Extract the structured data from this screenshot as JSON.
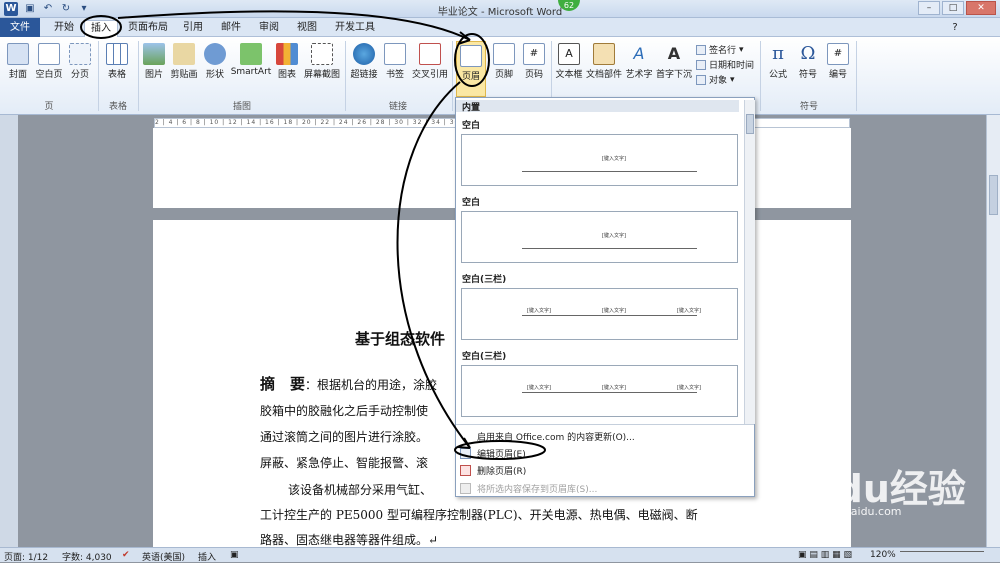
{
  "window": {
    "title": "毕业论文 - Microsoft Word",
    "badge": "62"
  },
  "tabs": {
    "file": "文件",
    "home": "开始",
    "insert": "插入",
    "layout": "页面布局",
    "ref": "引用",
    "mail": "邮件",
    "review": "审阅",
    "view": "视图",
    "dev": "开发工具"
  },
  "ribbon": {
    "cover": "封面",
    "blank": "空白页",
    "pagebreak": "分页",
    "table": "表格",
    "picture": "图片",
    "clipart": "剪贴画",
    "shapes": "形状",
    "smartart": "SmartArt",
    "chart": "图表",
    "screenshot": "屏幕截图",
    "hyperlink": "超链接",
    "bookmark": "书签",
    "crossref": "交叉引用",
    "header": "页眉",
    "footer": "页脚",
    "pagenum": "页码",
    "textbox": "文本框",
    "quickparts": "文档部件",
    "wordart": "艺术字",
    "dropcap": "首字下沉",
    "signature": "签名行",
    "datetime": "日期和时间",
    "object": "对象",
    "equation": "公式",
    "symbol": "符号",
    "number": "编号",
    "grp_pages": "页",
    "grp_tables": "表格",
    "grp_illus": "插图",
    "grp_links": "链接",
    "grp_symbols": "符号"
  },
  "ruler_text": "2 | 4 | 6 | 8 | 10 | 12 | 14 | 16 | 18 | 20 | 22 | 24 | 26 | 28 | 30 | 32 | 34 | 36 | 38",
  "document": {
    "title": "基于组态软件",
    "abstract_label": "摘　要",
    "lines": [
      "：根据机台的用途，涂胶",
      "胶箱中的胶融化之后手动控制使",
      "通过滚筒之间的图片进行涂胶。",
      "屏蔽、紧急停止、智能报警、滚",
      "该设备机械部分采用气缸、",
      "工计控生产的 PE5000 型可编程序控制器(PLC)、开关电源、热电偶、电磁阀、断",
      "路器、固态继电器等器件组成。↵"
    ]
  },
  "gallery": {
    "section": "内置",
    "items": [
      "空白",
      "空白",
      "空白(三栏)",
      "空白(三栏)"
    ],
    "placeholder": "[键入文字]",
    "menu": [
      "启用来自 Office.com 的内容更新(O)...",
      "编辑页眉(E)",
      "删除页眉(R)",
      "将所选内容保存到页眉库(S)..."
    ]
  },
  "status": {
    "page": "页面: 1/12",
    "words": "字数: 4,030",
    "lang": "英语(美国)",
    "mode": "插入",
    "zoom": "120%"
  },
  "watermark": {
    "brand": "Baidu经验",
    "url": "jingyan.baidu.com"
  },
  "colors": {
    "accent": "#2b579a",
    "ink": "#000000"
  }
}
